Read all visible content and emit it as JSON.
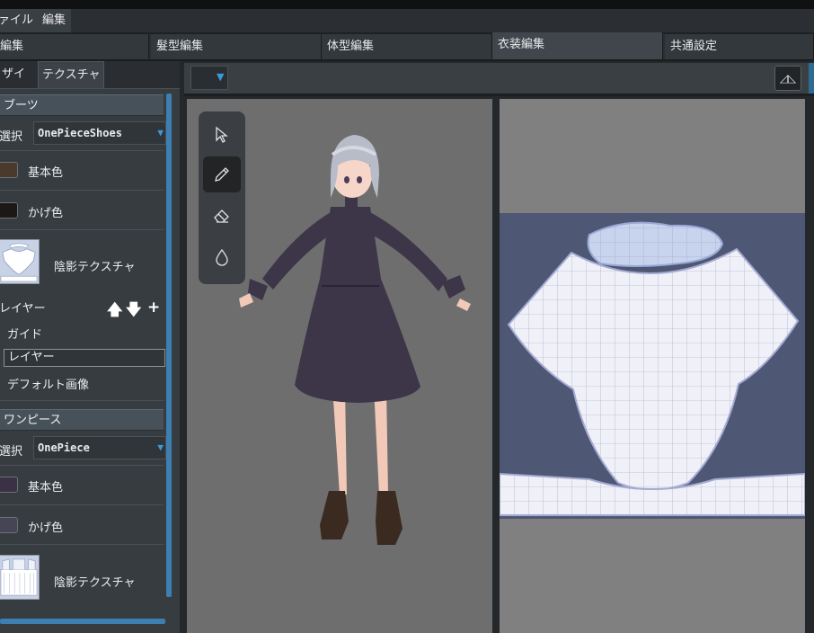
{
  "menu": {
    "items": [
      "ァイル",
      "編集"
    ]
  },
  "main_tabs": [
    {
      "label": "編集"
    },
    {
      "label": "髮型編集"
    },
    {
      "label": "体型編集"
    },
    {
      "label": "衣装編集"
    },
    {
      "label": "共通設定"
    }
  ],
  "sub_tabs": [
    {
      "label": "ザイン"
    },
    {
      "label": "テクスチャ"
    }
  ],
  "left": {
    "section1": {
      "header": "ブーツ",
      "select_label": "選択",
      "select_value": "OnePieceShoes",
      "base_color_label": "基本色",
      "shadow_color_label": "かげ色",
      "shade_texture_label": "陰影テクスチャ",
      "base_color": "#4a3a2c",
      "shadow_color": "#1c1816"
    },
    "layer": {
      "label": "レイヤー",
      "up_icon": "🡅",
      "down_icon": "🡇",
      "add_icon": "+",
      "items": [
        "ガイド",
        "レイヤー",
        "デフォルト画像"
      ]
    },
    "section2": {
      "header": "ワンピース",
      "select_label": "選択",
      "select_value": "OnePiece",
      "base_color_label": "基本色",
      "shadow_color_label": "かげ色",
      "shade_texture_label": "陰影テクスチャ",
      "base_color": "#3a3244",
      "shadow_color": "#454556"
    }
  },
  "toolbar": {
    "mirror_icon": "◿◺"
  },
  "tools": [
    "select-arrow-icon",
    "pencil-icon",
    "eraser-icon",
    "dropper-icon"
  ],
  "colors": {
    "accent": "#3a9bdc",
    "panel": "#373c41",
    "uv_background": "#4e5774"
  }
}
